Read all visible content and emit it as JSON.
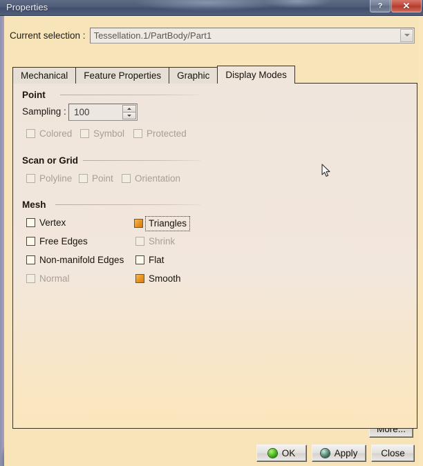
{
  "window": {
    "title": "Properties",
    "help_button": "?",
    "close_button": "✕"
  },
  "selection": {
    "label": "Current selection :",
    "value": "Tessellation.1/PartBody/Part1",
    "placeholder": "Tessellation.1/PartBody/Part1"
  },
  "tabs": [
    {
      "label": "Mechanical",
      "active": false
    },
    {
      "label": "Feature Properties",
      "active": false
    },
    {
      "label": "Graphic",
      "active": false
    },
    {
      "label": "Display Modes",
      "active": true
    }
  ],
  "groups": {
    "point": {
      "title": "Point",
      "sampling_label": "Sampling :",
      "sampling_value": "100",
      "checkboxes": [
        {
          "label": "Colored",
          "checked": false,
          "disabled": true
        },
        {
          "label": "Symbol",
          "checked": false,
          "disabled": true
        },
        {
          "label": "Protected",
          "checked": false,
          "disabled": true
        }
      ]
    },
    "scan_or_grid": {
      "title": "Scan or Grid",
      "checkboxes": [
        {
          "label": "Polyline",
          "checked": false,
          "disabled": true
        },
        {
          "label": "Point",
          "checked": false,
          "disabled": true
        },
        {
          "label": "Orientation",
          "checked": false,
          "disabled": true
        }
      ]
    },
    "mesh": {
      "title": "Mesh",
      "checkboxes": [
        {
          "label": "Vertex",
          "checked": false,
          "disabled": false,
          "focused": false
        },
        {
          "label": "Triangles",
          "checked": true,
          "disabled": false,
          "focused": true
        },
        {
          "label": "Free Edges",
          "checked": false,
          "disabled": false,
          "focused": false
        },
        {
          "label": "Shrink",
          "checked": false,
          "disabled": true,
          "focused": false
        },
        {
          "label": "Non-manifold Edges",
          "checked": false,
          "disabled": false,
          "focused": false
        },
        {
          "label": "Flat",
          "checked": false,
          "disabled": false,
          "focused": false
        },
        {
          "label": "Normal",
          "checked": false,
          "disabled": true,
          "focused": false
        },
        {
          "label": "Smooth",
          "checked": true,
          "disabled": false,
          "focused": false
        }
      ]
    }
  },
  "footer": {
    "more": "More...",
    "ok": "OK",
    "apply": "Apply",
    "close": "Close"
  },
  "colors": {
    "checked_accent": "#e8921f",
    "titlebar": "#4d5b78",
    "close_button": "#c04a3c",
    "dialog_bg": "#f8e4b9",
    "panel_bg": "#f0e5dc",
    "ok_sphere": "#55c22a",
    "apply_sphere": "#6f9d8a"
  }
}
